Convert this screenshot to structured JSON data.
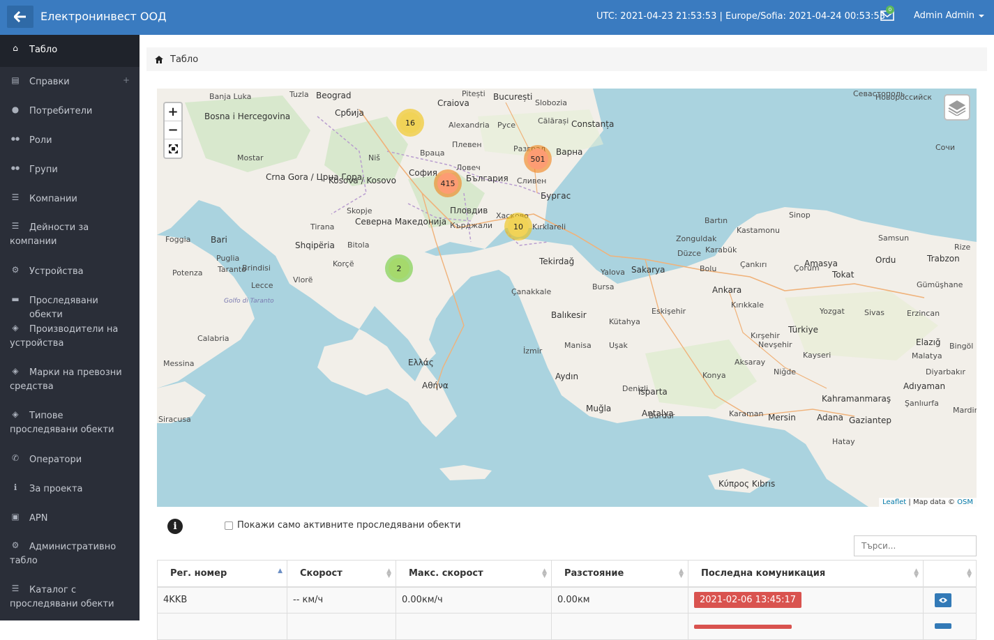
{
  "header": {
    "title": "Електронинвест ООД",
    "clock": "UTC: 2021-04-23 21:53:53 | Europe/Sofia: 2021-04-24 00:53:53",
    "unread_count": "0",
    "user": "Admin Admin"
  },
  "sidebar": {
    "items": [
      {
        "label": "Табло",
        "icon": "home-icon"
      },
      {
        "label": "Справки",
        "icon": "report-icon"
      },
      {
        "label": "Потребители",
        "icon": "user-icon"
      },
      {
        "label": "Роли",
        "icon": "users-icon"
      },
      {
        "label": "Групи",
        "icon": "users-icon"
      },
      {
        "label": "Компании",
        "icon": "list-icon"
      },
      {
        "label": "Дейности за компании",
        "icon": "list-icon"
      },
      {
        "label": "Устройства",
        "icon": "gears-icon"
      },
      {
        "label": "Проследявани обекти",
        "icon": "car-icon"
      },
      {
        "label": "Производители на устройства",
        "icon": "cubes-icon"
      },
      {
        "label": "Марки на превозни средства",
        "icon": "cubes-icon"
      },
      {
        "label": "Типове проследявани обекти",
        "icon": "cubes-icon"
      },
      {
        "label": "Оператори",
        "icon": "phone-icon"
      },
      {
        "label": "За проекта",
        "icon": "info-icon"
      },
      {
        "label": "APN",
        "icon": "apn-icon"
      },
      {
        "label": "Административно табло",
        "icon": "gears-icon"
      },
      {
        "label": "Каталог с проследявани обекти",
        "icon": "list-icon"
      }
    ]
  },
  "breadcrumb": {
    "label": "Табло"
  },
  "map": {
    "attribution_leaflet": "Leaflet",
    "attribution_text": "| Map data ©",
    "attribution_osm": "OSM",
    "clusters": [
      {
        "count": "16",
        "color": "#f1d357",
        "ring": "rgba(240,194,12,0.6)"
      },
      {
        "count": "501",
        "color": "#fd9c73",
        "ring": "rgba(241,128,23,0.6)"
      },
      {
        "count": "415",
        "color": "#fd9c73",
        "ring": "rgba(241,128,23,0.6)"
      },
      {
        "count": "10",
        "color": "#f1d357",
        "ring": "rgba(240,194,12,0.6)"
      },
      {
        "count": "2",
        "color": "#a5d96c",
        "ring": "rgba(110,204,57,0.6)"
      }
    ],
    "labels": [
      "Beograd",
      "Србија",
      "București",
      "Craiova",
      "Alexandria",
      "Плевен",
      "Варна",
      "Constanța",
      "София",
      "България",
      "Бургас",
      "Пловдив",
      "Кърджали",
      "Kırklareli",
      "Skopje",
      "Северна Македонија",
      "Shqipëria",
      "Tirana",
      "Ελλάς",
      "Αθήνα",
      "Tekirdağ",
      "Balıkesir",
      "Türkiye",
      "Ankara",
      "İzmir",
      "Aydın",
      "Antalya",
      "Isparta",
      "Muğla",
      "Konya",
      "Kayseri",
      "Adana",
      "Mersin",
      "Trabzon",
      "Ordu",
      "Samsun",
      "Sinop",
      "Sakarya",
      "Bari",
      "Foggia",
      "Taranto",
      "Lecce",
      "Messina",
      "Κύπρος Kıbrıs",
      "Kosova / Kosovo",
      "Crna Gora / Црна Гора",
      "Bosna i Hercegovina",
      "Niš",
      "Bitola",
      "Korçë",
      "Vlorë",
      "Çanakkale",
      "Bursa",
      "Eskişehir",
      "Kütahya",
      "Gaziantep",
      "Kahramanmaraş",
      "Elazığ",
      "Tokat",
      "Amasya",
      "Çorum",
      "Yozgat",
      "Sivas",
      "Erzincan",
      "Zonguldak",
      "Karabük",
      "Kastamonu",
      "Bartın",
      "Çankırı",
      "Kırıkkale",
      "Kırşehir",
      "Nevşehir",
      "Aksaray",
      "Niğde",
      "Karaman",
      "Burdur",
      "Denizli",
      "Manisa",
      "Uşak",
      "Bolu",
      "Düzce",
      "Yalova",
      "Malatya",
      "Adıyaman",
      "Şanlıurfa",
      "Hatay",
      "Сочи",
      "Новороссийск",
      "Севастополь",
      "Русе",
      "Враца",
      "Ловеч",
      "Хасково",
      "Сливен",
      "Разград",
      "Călărași",
      "Slobozia",
      "Pitești",
      "Tuzla",
      "Banja Luka",
      "Mostar",
      "Potenza",
      "Brindisi",
      "Puglia",
      "Calabria",
      "Golfo di Taranto",
      "Siracusa",
      "Gümüşhane",
      "Rize",
      "Bingöl",
      "Diyarbakır",
      "Mardin"
    ]
  },
  "filter": {
    "info_glyph": "i",
    "active_only_label": "Покажи само активните проследявани обекти",
    "search_placeholder": "Търси..."
  },
  "table": {
    "columns": [
      "Рег. номер",
      "Скорост",
      "Макс. скорост",
      "Разстояние",
      "Последна комуникация",
      ""
    ],
    "rows": [
      {
        "reg": "4KKB",
        "speed": "-- км/ч",
        "max_speed": "0.00км/ч",
        "distance": "0.00км",
        "last_comm": "2021-02-06 13:45:17"
      }
    ]
  }
}
